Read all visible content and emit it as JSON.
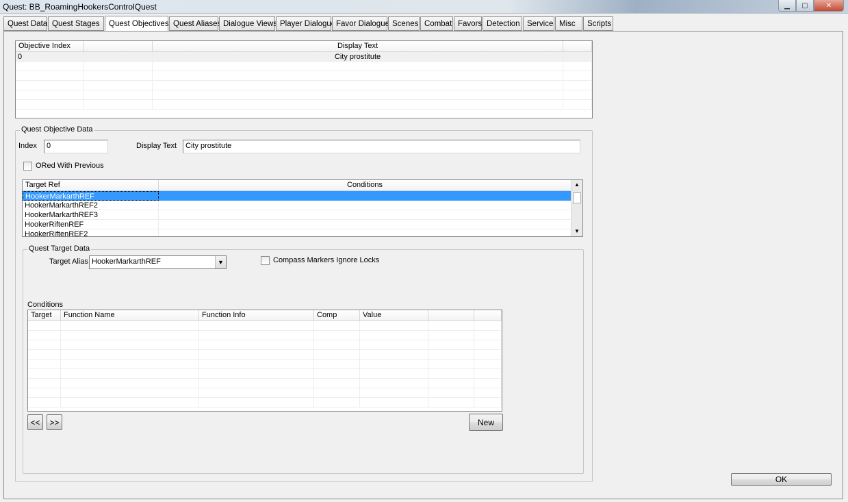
{
  "window": {
    "title": "Quest: BB_RoamingHookersControlQuest"
  },
  "tabs": [
    {
      "label": "Quest Data"
    },
    {
      "label": "Quest Stages"
    },
    {
      "label": "Quest Objectives"
    },
    {
      "label": "Quest Aliases"
    },
    {
      "label": "Dialogue Views"
    },
    {
      "label": "Player Dialogue"
    },
    {
      "label": "Favor Dialogue"
    },
    {
      "label": "Scenes"
    },
    {
      "label": "Combat"
    },
    {
      "label": "Favors"
    },
    {
      "label": "Detection"
    },
    {
      "label": "Service"
    },
    {
      "label": "Misc"
    },
    {
      "label": "Scripts"
    }
  ],
  "active_tab": "Quest Objectives",
  "objectives_list": {
    "columns": [
      "Objective Index",
      "",
      "Display Text",
      ""
    ],
    "rows": [
      {
        "index": "0",
        "display_text": "City prostitute"
      }
    ]
  },
  "objective_data": {
    "group_label": "Quest Objective Data",
    "index_label": "Index",
    "index_value": "0",
    "display_text_label": "Display Text",
    "display_text_value": "City prostitute",
    "ored_label": "ORed With Previous"
  },
  "targets_list": {
    "columns": [
      "Target Ref",
      "Conditions"
    ],
    "rows": [
      "HookerMarkarthREF",
      "HookerMarkarthREF2",
      "HookerMarkarthREF3",
      "HookerRiftenREF",
      "HookerRiftenREF2"
    ],
    "selected_index": 0
  },
  "target_data": {
    "group_label": "Quest Target Data",
    "alias_label": "Target Alias",
    "alias_value": "HookerMarkarthREF",
    "compass_label": "Compass Markers Ignore Locks",
    "conditions_label": "Conditions",
    "conditions_columns": [
      "Target",
      "Function Name",
      "Function Info",
      "Comp",
      "Value",
      "",
      ""
    ],
    "prev_label": "<<",
    "next_label": ">>",
    "new_label": "New"
  },
  "ok_label": "OK",
  "colors": {
    "selection": "#3399ff",
    "tab_border": "#8d8d8d",
    "listview_border": "#828790"
  }
}
